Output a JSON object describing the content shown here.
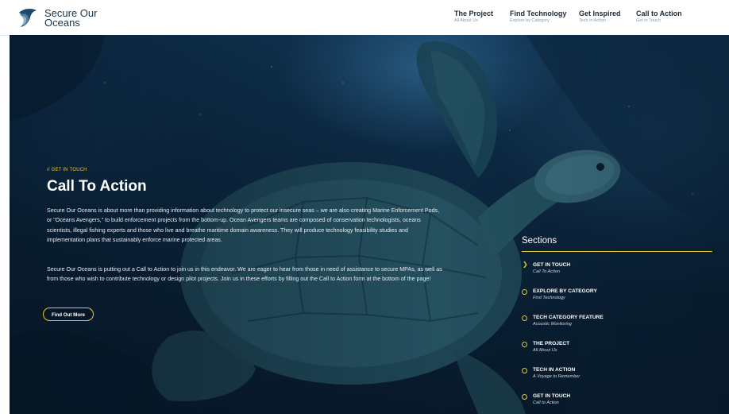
{
  "brand": {
    "line1": "Secure Our",
    "line2": "Oceans"
  },
  "nav": [
    {
      "title": "The Project",
      "subtitle": "All About Us"
    },
    {
      "title": "Find Technology",
      "subtitle": "Explore by Category"
    },
    {
      "title": "Get Inspired",
      "subtitle": "Tech in Action"
    },
    {
      "title": "Call to Action",
      "subtitle": "Get in Touch"
    }
  ],
  "hero": {
    "eyebrow": "// GET IN TOUCH",
    "title": "Call To Action",
    "paragraph1": "Secure Our Oceans is about more than providing information about technology to protect our insecure seas – we are also creating Marine Enforcement Pods, or \"Oceans Avengers,\" to build enforcement projects from the bottom-up. Ocean Avengers teams are composed of conservation technologists, oceans scientists, illegal fishing experts and those who live and breathe maritime domain awareness. They will produce technology feasibility studies and implementation plans that sustainably enforce marine protected areas.",
    "paragraph2": "Secure Our Oceans is putting out a Call to Action to join us in this endeavor. We are eager to hear from those in need of assistance to secure MPAs, as well as from those who wish to contribute technology or design pilot projects. Join us in these efforts by filling out the Call to Action form at the bottom of the page!",
    "button": "Find Out More"
  },
  "sections": {
    "title": "Sections",
    "items": [
      {
        "title": "GET IN TOUCH",
        "subtitle": "Call To Action",
        "active": true
      },
      {
        "title": "EXPLORE BY CATEGORY",
        "subtitle": "Find Technology",
        "active": false
      },
      {
        "title": "TECH CATEGORY FEATURE",
        "subtitle": "Acoustic Monitoring",
        "active": false
      },
      {
        "title": "THE PROJECT",
        "subtitle": "All About Us",
        "active": false
      },
      {
        "title": "TECH IN ACTION",
        "subtitle": "A Voyage to Remember",
        "active": false
      },
      {
        "title": "GET IN TOUCH",
        "subtitle": "Call to Action",
        "active": false
      }
    ]
  },
  "colors": {
    "accent": "#e4c832",
    "navy": "#1c3346",
    "ocean": "#0d2c47"
  },
  "icons": {
    "logo": "wave-shield-logo",
    "active_marker": "chevron-right-icon",
    "marker": "circle-icon"
  }
}
